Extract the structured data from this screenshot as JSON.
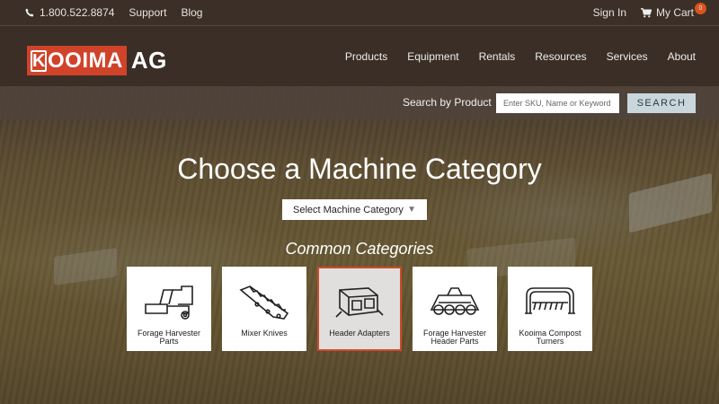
{
  "topbar": {
    "phone": "1.800.522.8874",
    "support": "Support",
    "blog": "Blog",
    "sign_in": "Sign In",
    "cart": "My Cart",
    "cart_count": "0"
  },
  "header": {
    "logo_main": "OOIMA",
    "logo_k": "K",
    "logo_suffix": "AG",
    "nav": [
      "Products",
      "Equipment",
      "Rentals",
      "Resources",
      "Services",
      "About"
    ]
  },
  "search": {
    "label": "Search by Product",
    "placeholder": "Enter SKU, Name or Keyword",
    "button": "SEARCH"
  },
  "hero": {
    "title": "Choose a Machine Category",
    "select_value": "Select Machine Category",
    "subtitle": "Common Categories"
  },
  "categories": [
    {
      "label": "Forage Harvester Parts",
      "icon": "harvester-icon",
      "active": false
    },
    {
      "label": "Mixer Knives",
      "icon": "knife-icon",
      "active": false
    },
    {
      "label": "Header Adapters",
      "icon": "adapter-icon",
      "active": true
    },
    {
      "label": "Forage Harvester Header Parts",
      "icon": "header-icon",
      "active": false
    },
    {
      "label": "Kooima Compost Turners",
      "icon": "turner-icon",
      "active": false
    }
  ],
  "colors": {
    "accent": "#d0432a",
    "header_bg": "#3a2e27",
    "search_btn": "#c9d6dc"
  }
}
